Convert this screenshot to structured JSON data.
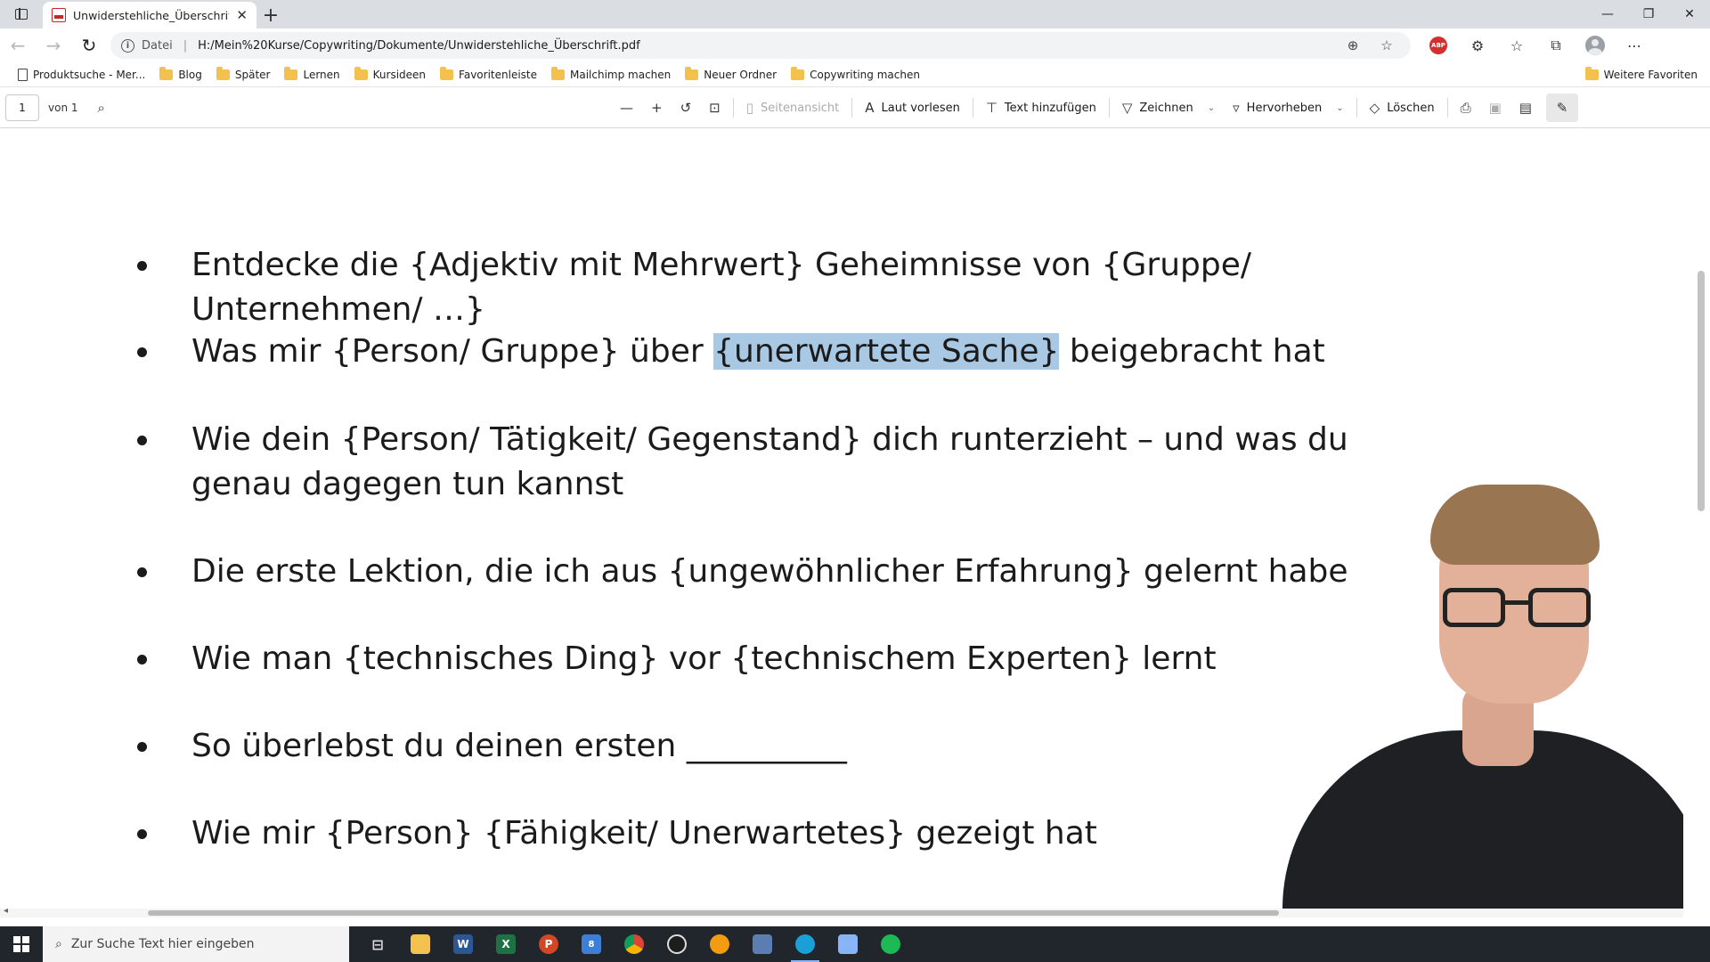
{
  "browser": {
    "tab_title": "Unwiderstehliche_Überschrift.pdf",
    "address": {
      "scheme_label": "Datei",
      "url": "H:/Mein%20Kurse/Copywriting/Dokumente/Unwiderstehliche_Überschrift.pdf"
    }
  },
  "favorites": {
    "items": [
      {
        "label": "Produktsuche - Mer...",
        "icon": "page-icon"
      },
      {
        "label": "Blog",
        "icon": "folder-icon"
      },
      {
        "label": "Später",
        "icon": "folder-icon"
      },
      {
        "label": "Lernen",
        "icon": "folder-icon"
      },
      {
        "label": "Kursideen",
        "icon": "folder-icon"
      },
      {
        "label": "Favoritenleiste",
        "icon": "folder-icon"
      },
      {
        "label": "Mailchimp machen",
        "icon": "folder-icon"
      },
      {
        "label": "Neuer Ordner",
        "icon": "folder-icon"
      },
      {
        "label": "Copywriting machen",
        "icon": "folder-icon"
      }
    ],
    "more_label": "Weitere Favoriten"
  },
  "pdf_toolbar": {
    "page_current": "1",
    "page_count": "von 1",
    "page_view": "Seitenansicht",
    "read_aloud": "Laut vorlesen",
    "add_text": "Text hinzufügen",
    "draw": "Zeichnen",
    "highlight": "Hervorheben",
    "erase": "Löschen"
  },
  "document": {
    "bullets": [
      {
        "text": "Entdecke die {Adjektiv mit Mehrwert} Geheimnisse von {Gruppe/ Unternehmen/ …}"
      },
      {
        "pre": "Was mir {Person/ Gruppe} über ",
        "highlight": "{unerwartete Sache}",
        "post": " beigebracht hat"
      },
      {
        "text": "Wie dein {Person/ Tätigkeit/ Gegenstand} dich runterzieht – und was du genau dagegen tun kannst"
      },
      {
        "text": "Die erste Lektion, die ich aus {ungewöhnlicher Erfahrung} gelernt habe"
      },
      {
        "text": "Wie man {technisches Ding} vor {technischem Experten} lernt"
      },
      {
        "text": "So überlebst du deinen ersten __________"
      },
      {
        "text": "Wie mir {Person} {Fähigkeit/ Unerwartetes} gezeigt hat"
      }
    ]
  },
  "taskbar": {
    "search_placeholder": "Zur Suche Text hier eingeben",
    "mail_badge": "8"
  },
  "colors": {
    "highlight": "#a9c8e3",
    "taskbar": "#20262c",
    "tabstrip": "#dadee3"
  }
}
